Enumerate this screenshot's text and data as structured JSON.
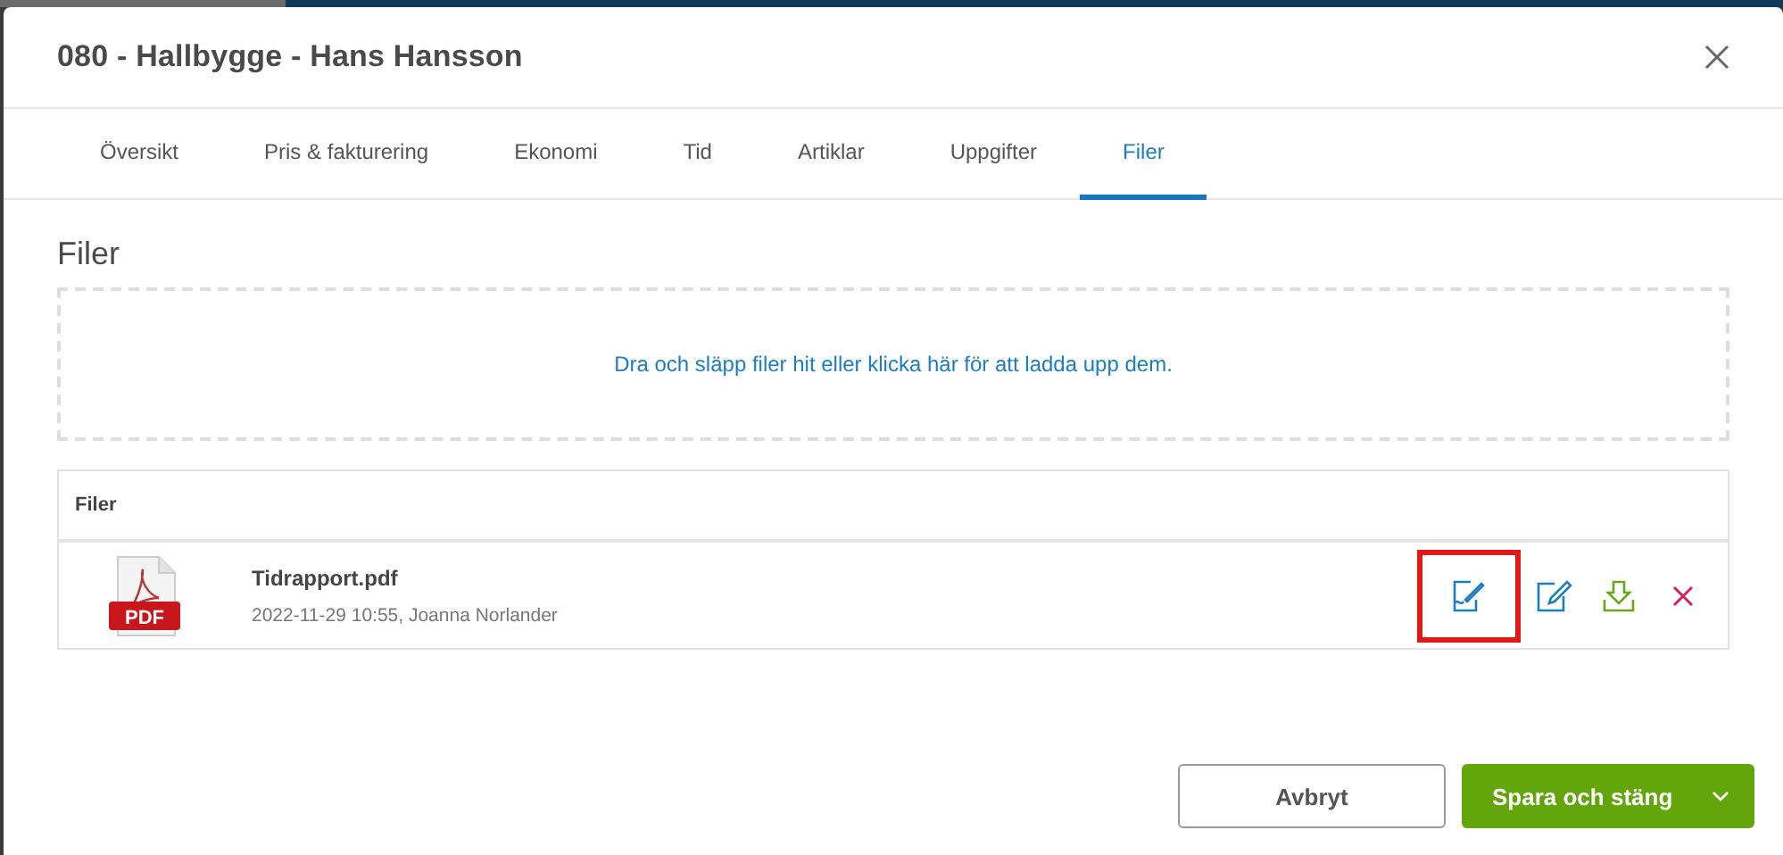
{
  "dialog": {
    "title": "080 - Hallbygge - Hans Hansson"
  },
  "tabs": [
    {
      "label": "Översikt",
      "selected": false
    },
    {
      "label": "Pris & fakturering",
      "selected": false
    },
    {
      "label": "Ekonomi",
      "selected": false
    },
    {
      "label": "Tid",
      "selected": false
    },
    {
      "label": "Artiklar",
      "selected": false
    },
    {
      "label": "Uppgifter",
      "selected": false
    },
    {
      "label": "Filer",
      "selected": true
    }
  ],
  "section": {
    "heading": "Filer",
    "dropzone": "Dra och släpp filer hit eller klicka här för att ladda upp dem."
  },
  "table": {
    "header": "Filer",
    "rows": [
      {
        "name": "Tidrapport.pdf",
        "meta": "2022-11-29 10:55, Joanna Norlander",
        "file_badge": "PDF",
        "actions": [
          {
            "kind": "sign",
            "highlighted": true
          },
          {
            "kind": "edit",
            "highlighted": false
          },
          {
            "kind": "download",
            "highlighted": false
          },
          {
            "kind": "delete",
            "highlighted": false
          }
        ]
      }
    ]
  },
  "footer": {
    "cancel": "Avbryt",
    "save": "Spara och stäng"
  }
}
